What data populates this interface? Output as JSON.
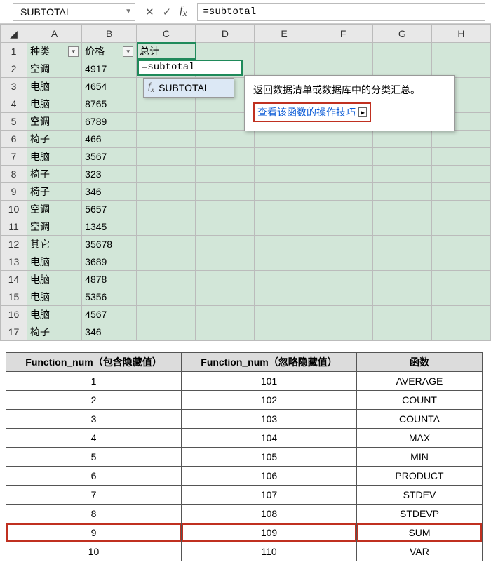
{
  "nameBox": "SUBTOTAL",
  "formulaText": "=subtotal",
  "cellEditText": "=subtotal",
  "acItem": "SUBTOTAL",
  "tooltip": {
    "desc": "返回数据清单或数据库中的分类汇总。",
    "link": "查看该函数的操作技巧"
  },
  "cols": [
    "A",
    "B",
    "C",
    "D",
    "E",
    "F",
    "G",
    "H"
  ],
  "header": {
    "A": "种类",
    "B": "价格",
    "C": "总计"
  },
  "rows": [
    {
      "n": 1,
      "A": "种类",
      "B": "价格",
      "C": "总计",
      "hdr": true
    },
    {
      "n": 2,
      "A": "空调",
      "B": "4917"
    },
    {
      "n": 3,
      "A": "电脑",
      "B": "4654"
    },
    {
      "n": 4,
      "A": "电脑",
      "B": "8765"
    },
    {
      "n": 5,
      "A": "空调",
      "B": "6789"
    },
    {
      "n": 6,
      "A": "椅子",
      "B": "466"
    },
    {
      "n": 7,
      "A": "电脑",
      "B": "3567"
    },
    {
      "n": 8,
      "A": "椅子",
      "B": "323"
    },
    {
      "n": 9,
      "A": "椅子",
      "B": "346"
    },
    {
      "n": 10,
      "A": "空调",
      "B": "5657"
    },
    {
      "n": 11,
      "A": "空调",
      "B": "1345"
    },
    {
      "n": 12,
      "A": "其它",
      "B": "35678"
    },
    {
      "n": 13,
      "A": "电脑",
      "B": "3689"
    },
    {
      "n": 14,
      "A": "电脑",
      "B": "4878"
    },
    {
      "n": 15,
      "A": "电脑",
      "B": "5356"
    },
    {
      "n": 16,
      "A": "电脑",
      "B": "4567"
    },
    {
      "n": 17,
      "A": "椅子",
      "B": "346"
    }
  ],
  "refHeaders": [
    "Function_num（包含隐藏值）",
    "Function_num（忽略隐藏值）",
    "函数"
  ],
  "refRows": [
    {
      "a": "1",
      "b": "101",
      "c": "AVERAGE"
    },
    {
      "a": "2",
      "b": "102",
      "c": "COUNT"
    },
    {
      "a": "3",
      "b": "103",
      "c": "COUNTA"
    },
    {
      "a": "4",
      "b": "104",
      "c": "MAX"
    },
    {
      "a": "5",
      "b": "105",
      "c": "MIN"
    },
    {
      "a": "6",
      "b": "106",
      "c": "PRODUCT"
    },
    {
      "a": "7",
      "b": "107",
      "c": "STDEV"
    },
    {
      "a": "8",
      "b": "108",
      "c": "STDEVP"
    },
    {
      "a": "9",
      "b": "109",
      "c": "SUM",
      "hl": true
    },
    {
      "a": "10",
      "b": "110",
      "c": "VAR"
    }
  ]
}
